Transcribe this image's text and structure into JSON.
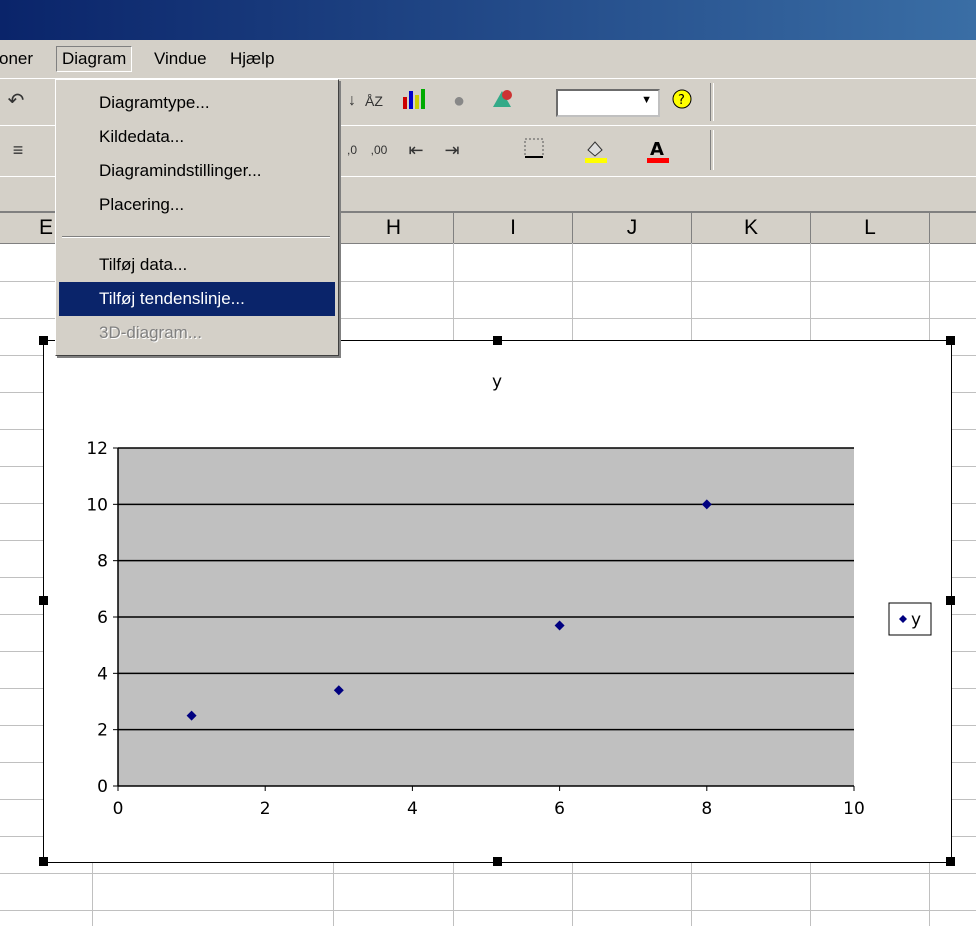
{
  "menubar": {
    "items": [
      {
        "label": "oner"
      },
      {
        "label": "Diagram"
      },
      {
        "label": "Vindue"
      },
      {
        "label": "Hjælp"
      }
    ]
  },
  "columns": [
    "E",
    "H",
    "I",
    "J",
    "K",
    "L"
  ],
  "diagram_menu": {
    "items": [
      {
        "label": "Diagramtype...",
        "state": "normal"
      },
      {
        "label": "Kildedata...",
        "state": "normal"
      },
      {
        "label": "Diagramindstillinger...",
        "state": "normal"
      },
      {
        "label": "Placering...",
        "state": "normal"
      },
      {
        "label": "Tilføj data...",
        "state": "normal"
      },
      {
        "label": "Tilføj tendenslinje...",
        "state": "highlighted"
      },
      {
        "label": "3D-diagram...",
        "state": "disabled"
      }
    ]
  },
  "toolbar": {
    "icons": [
      "undo-icon",
      "sort-ascending-icon",
      "sort-descending-icon",
      "chart-wizard-icon",
      "map-icon",
      "drawing-icon",
      "zoom-dropdown",
      "help-icon",
      "align-left-icon",
      "increase-decimal-icon",
      "decrease-decimal-icon",
      "decrease-indent-icon",
      "increase-indent-icon",
      "borders-icon",
      "fill-color-icon",
      "font-color-icon"
    ],
    "fill_color": "#ffff00",
    "font_color": "#ff0000"
  },
  "chart_data": {
    "type": "scatter",
    "title": "y",
    "xlabel": "",
    "ylabel": "",
    "xlim": [
      0,
      10
    ],
    "ylim": [
      0,
      12
    ],
    "xticks": [
      0,
      2,
      4,
      6,
      8,
      10
    ],
    "yticks": [
      0,
      2,
      4,
      6,
      8,
      10,
      12
    ],
    "grid": "horizontal",
    "plot_background": "#c0c0c0",
    "marker_color": "#000080",
    "marker": "diamond",
    "series": [
      {
        "name": "y",
        "x": [
          1,
          3,
          6,
          8
        ],
        "y": [
          2.5,
          3.4,
          5.7,
          10
        ]
      }
    ],
    "legend": {
      "position": "right",
      "entries": [
        "y"
      ]
    }
  }
}
